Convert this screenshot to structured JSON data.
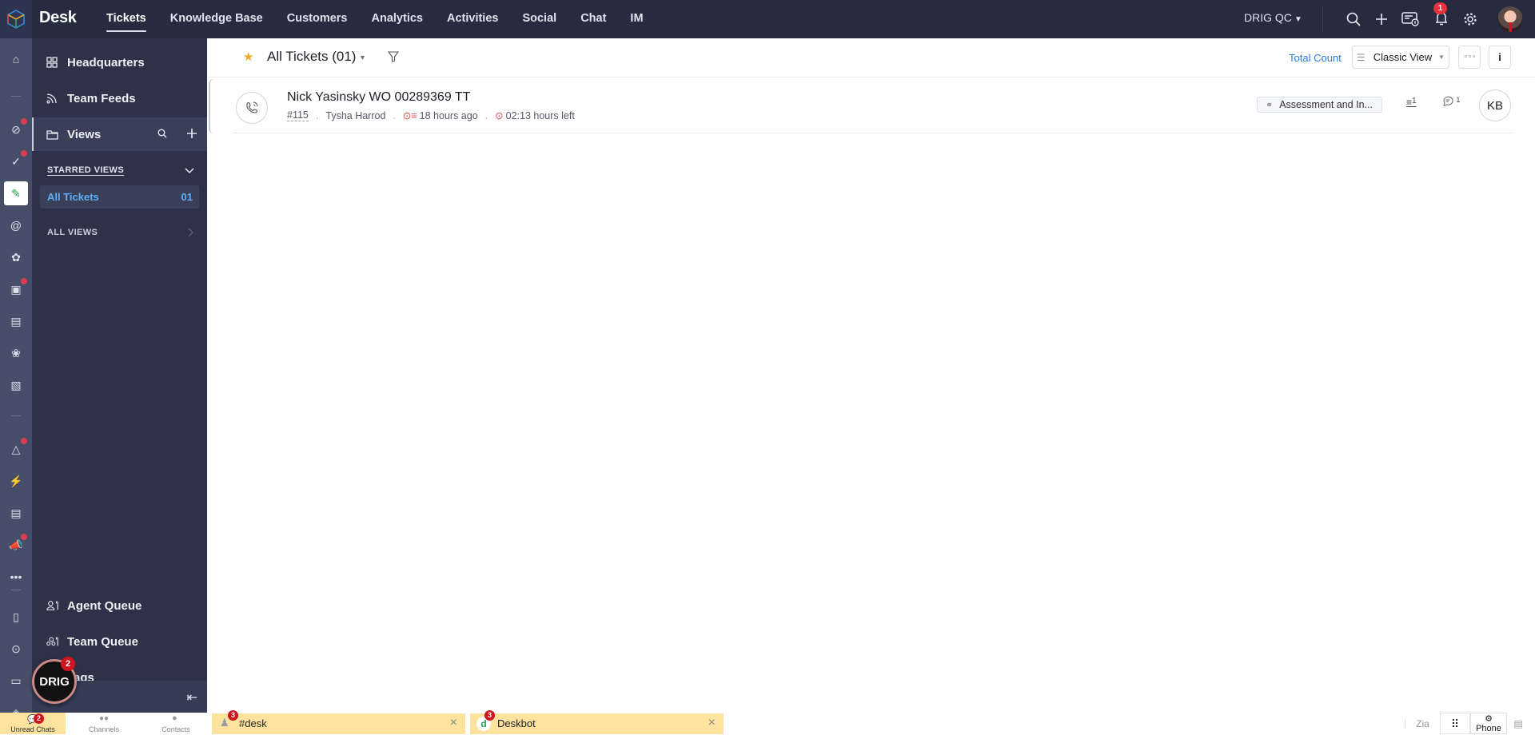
{
  "app": {
    "name": "Desk",
    "org": "DRIG QC",
    "nav": [
      {
        "label": "Tickets",
        "active": true
      },
      {
        "label": "Knowledge Base",
        "active": false
      },
      {
        "label": "Customers",
        "active": false
      },
      {
        "label": "Analytics",
        "active": false
      },
      {
        "label": "Activities",
        "active": false
      },
      {
        "label": "Social",
        "active": false
      },
      {
        "label": "Chat",
        "active": false
      },
      {
        "label": "IM",
        "active": false
      }
    ],
    "top_icons": [
      "search-icon",
      "plus-icon",
      "ticket-info-icon",
      "bell-icon",
      "gear-icon",
      "user-avatar"
    ],
    "notification_count": "1"
  },
  "rail": {
    "icons": [
      {
        "name": "home-icon",
        "dot": false
      },
      {
        "name": "link-chat-icon",
        "dot": true
      },
      {
        "name": "checks-icon",
        "dot": true
      },
      {
        "name": "tickets-icon",
        "dot": false,
        "active": true
      },
      {
        "name": "at-mention-icon",
        "dot": false
      },
      {
        "name": "flower-icon",
        "dot": false
      },
      {
        "name": "analytics-folder-icon",
        "dot": true
      },
      {
        "name": "documents-icon",
        "dot": false
      },
      {
        "name": "cubes-icon",
        "dot": false
      },
      {
        "name": "settings-card-icon",
        "dot": false
      },
      {
        "name": "mountain-icon",
        "dot": true
      },
      {
        "name": "lightning-icon",
        "dot": false
      },
      {
        "name": "note-icon",
        "dot": false
      },
      {
        "name": "megaphone-icon",
        "dot": true
      },
      {
        "name": "more-icon",
        "dot": false
      },
      {
        "name": "contact-book-icon",
        "dot": false
      },
      {
        "name": "search-zoom-icon",
        "dot": false
      },
      {
        "name": "wallet-icon",
        "dot": false
      },
      {
        "name": "tag-check-icon",
        "dot": false
      }
    ]
  },
  "panel": {
    "headquarters": "Headquarters",
    "team_feeds": "Team Feeds",
    "views": "Views",
    "starred_views": "STARRED VIEWS",
    "starred": [
      {
        "name": "All Tickets",
        "count": "01"
      }
    ],
    "all_views": "ALL VIEWS",
    "agent_queue": "Agent Queue",
    "team_queue": "Team Queue",
    "tags": "Tags"
  },
  "main": {
    "view_title": "All Tickets (01)",
    "total_count": "Total Count",
    "view_mode": "Classic View",
    "tickets": [
      {
        "subject": "Nick Yasinsky WO 00289369 TT",
        "number": "#115",
        "contact": "Tysha Harrod",
        "created": "18 hours ago",
        "due": "02:13 hours left",
        "tag": "Assessment and In...",
        "threads": "1",
        "comments": "1",
        "assignee": "KB",
        "channel": "phone"
      }
    ]
  },
  "chatbar": {
    "tabs": [
      {
        "label": "Unread Chats",
        "badge": "2",
        "active": true
      },
      {
        "label": "Channels",
        "active": false
      },
      {
        "label": "Contacts",
        "active": false
      }
    ],
    "floating_badge": "2",
    "floating_label": "DRIG",
    "windows": [
      {
        "title": "#desk",
        "badge": "3"
      },
      {
        "title": "Deskbot",
        "badge": "3"
      }
    ],
    "phone_label": "Phone"
  }
}
